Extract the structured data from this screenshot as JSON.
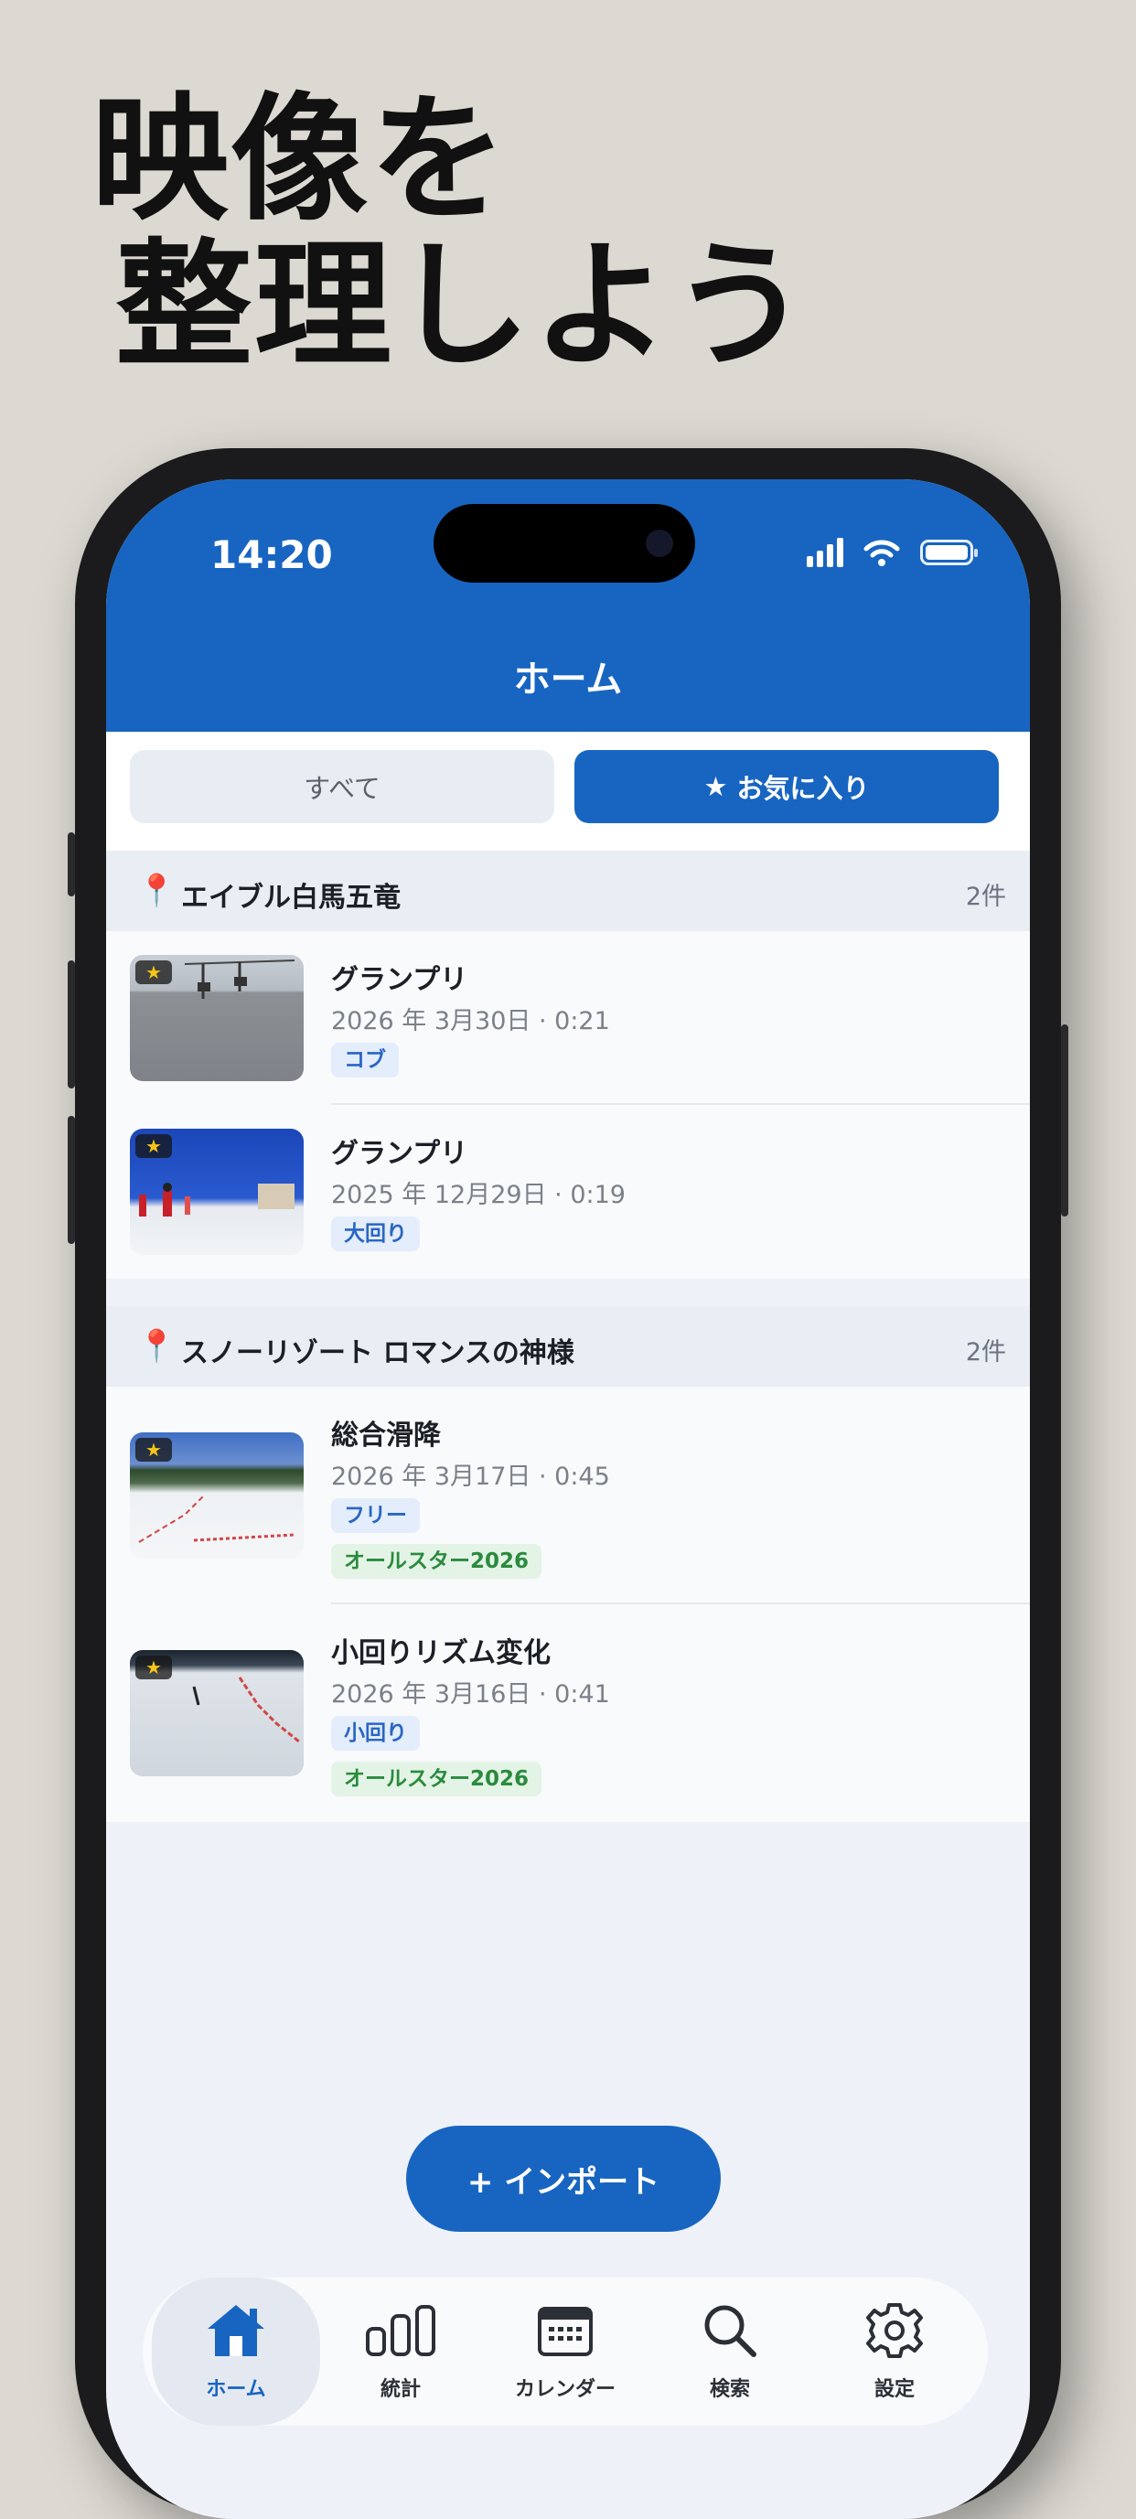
{
  "promo": {
    "line1": "映像を",
    "line2": "整理しよう"
  },
  "status_bar": {
    "time": "14:20"
  },
  "nav": {
    "title": "ホーム"
  },
  "segments": {
    "all": "すべて",
    "favorites": "お気に入り",
    "favorites_icon": "star-icon",
    "selected": "favorites"
  },
  "sections": [
    {
      "place": "エイブル白馬五竜",
      "count": "2件",
      "videos": [
        {
          "title": "グランプリ",
          "meta": "2026 年 3月30日 · 0:21",
          "tags": [
            "コブ"
          ],
          "favorite": true
        },
        {
          "title": "グランプリ",
          "meta": "2025 年 12月29日 · 0:19",
          "tags": [
            "大回り"
          ],
          "favorite": true
        }
      ]
    },
    {
      "place": "スノーリゾート ロマンスの神様",
      "count": "2件",
      "videos": [
        {
          "title": "総合滑降",
          "meta": "2026 年 3月17日 · 0:45",
          "tags": [
            "フリー"
          ],
          "event": "オールスター2026",
          "favorite": true
        },
        {
          "title": "小回りリズム変化",
          "meta": "2026 年 3月16日 · 0:41",
          "tags": [
            "小回り"
          ],
          "event": "オールスター2026",
          "favorite": true
        }
      ]
    }
  ],
  "import_button": {
    "label": "+ インポート"
  },
  "tabs": [
    {
      "label": "ホーム",
      "icon": "home-icon",
      "active": true
    },
    {
      "label": "統計",
      "icon": "bar-chart-icon",
      "active": false
    },
    {
      "label": "カレンダー",
      "icon": "calendar-icon",
      "active": false
    },
    {
      "label": "検索",
      "icon": "search-icon",
      "active": false
    },
    {
      "label": "設定",
      "icon": "gear-icon",
      "active": false
    }
  ],
  "colors": {
    "brand": "#1865c1",
    "background": "#dcd9d2",
    "tag_blue": "#e3edfb",
    "tag_green": "#e3f4e6"
  }
}
